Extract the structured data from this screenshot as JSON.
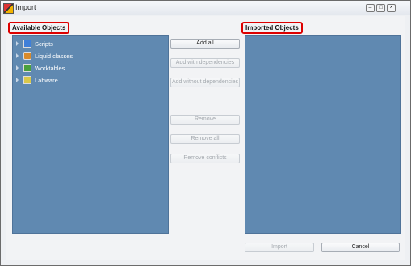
{
  "window": {
    "title": "Import"
  },
  "available": {
    "label": "Available Objects",
    "items": [
      {
        "label": "Scripts",
        "icon": "scripts-icon"
      },
      {
        "label": "Liquid classes",
        "icon": "liquid-classes-icon"
      },
      {
        "label": "Worktables",
        "icon": "worktables-icon"
      },
      {
        "label": "Labware",
        "icon": "labware-icon"
      }
    ]
  },
  "imported": {
    "label": "Imported Objects"
  },
  "buttons": {
    "add_all": "Add all",
    "add_with_dependencies": "Add with dependencies",
    "add_without_dependencies": "Add without dependencies",
    "remove": "Remove",
    "remove_all": "Remove all",
    "remove_conflicts": "Remove conflicts",
    "import": "Import",
    "cancel": "Cancel"
  },
  "colors": {
    "panel": "#6089b1",
    "highlight_border": "#dd0000"
  }
}
